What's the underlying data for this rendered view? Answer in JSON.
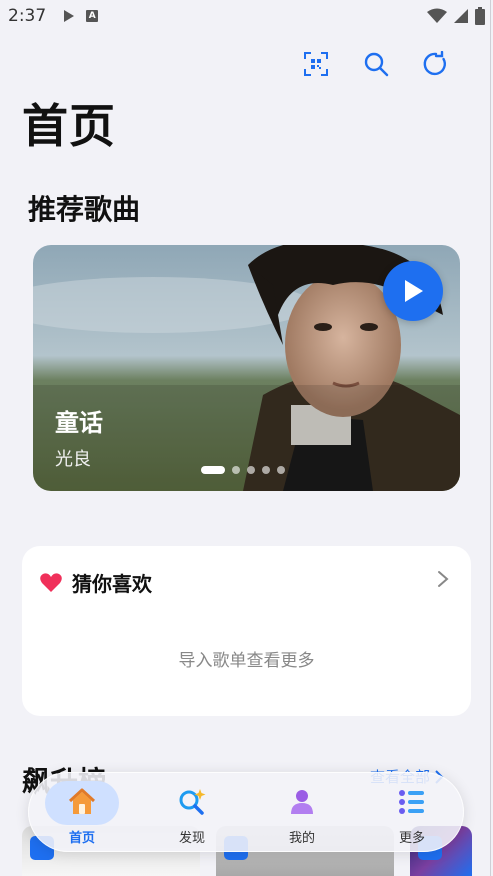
{
  "status_bar": {
    "time": "2:37"
  },
  "header": {
    "title": "首页"
  },
  "recommend": {
    "section_title": "推荐歌曲",
    "song": "童话",
    "artist": "光良",
    "carousel_total": 5,
    "carousel_active_index": 0
  },
  "guess": {
    "title": "猜你喜欢",
    "empty_text": "导入歌单查看更多"
  },
  "ranking": {
    "title": "飙升榜",
    "more_label": "查看全部"
  },
  "bottom_nav": {
    "items": [
      {
        "label": "首页",
        "icon": "home-icon",
        "active": true
      },
      {
        "label": "发现",
        "icon": "discover-icon",
        "active": false
      },
      {
        "label": "我的",
        "icon": "user-icon",
        "active": false
      },
      {
        "label": "更多",
        "icon": "list-icon",
        "active": false
      }
    ]
  },
  "colors": {
    "accent": "#1e6ff0",
    "heart": "#f0305a",
    "background": "#f2f2f7",
    "nav_active_pill": "#cfe0ff"
  }
}
